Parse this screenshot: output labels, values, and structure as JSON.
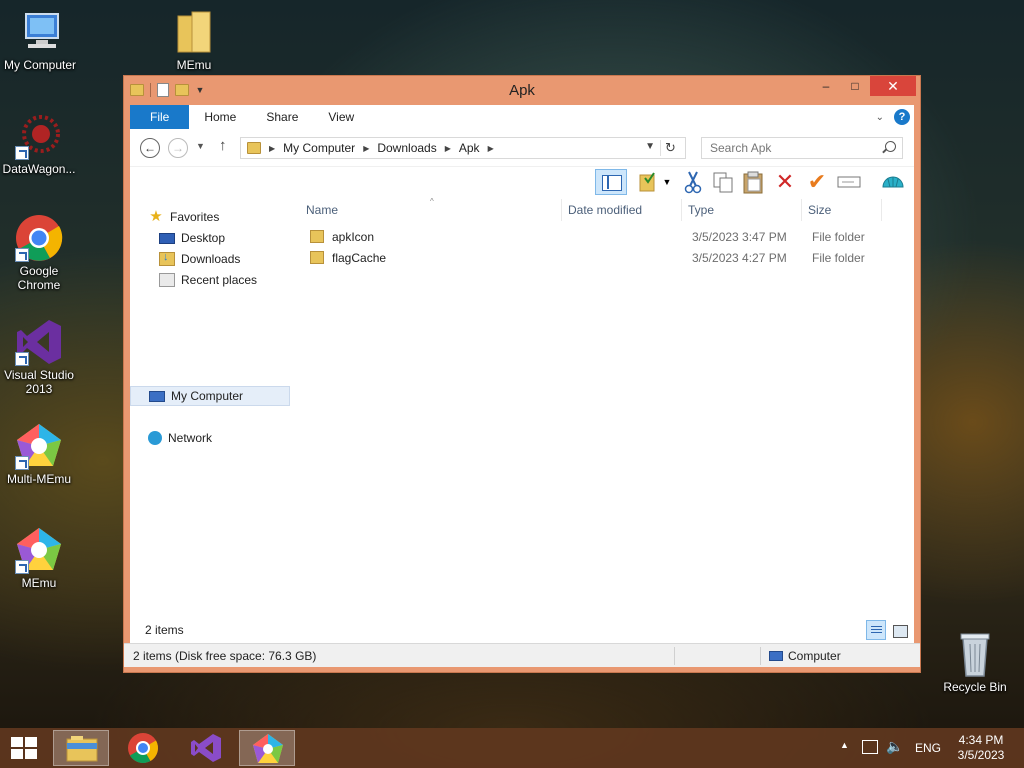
{
  "desktop": {
    "icons": [
      {
        "label": "My Computer"
      },
      {
        "label": "MEmu"
      },
      {
        "label": "DataWagon..."
      },
      {
        "label": "Google Chrome"
      },
      {
        "label": "Visual Studio 2013"
      },
      {
        "label": "Multi-MEmu"
      },
      {
        "label": "MEmu"
      },
      {
        "label": "Recycle Bin"
      }
    ]
  },
  "window": {
    "title": "Apk",
    "controls": {
      "minimize": "–",
      "maximize": "□",
      "close": "✕"
    },
    "ribbon_tabs": [
      {
        "label": "File"
      },
      {
        "label": "Home"
      },
      {
        "label": "Share"
      },
      {
        "label": "View"
      }
    ],
    "address": {
      "crumbs": [
        "My Computer",
        "Downloads",
        "Apk"
      ]
    },
    "search": {
      "placeholder": "Search Apk"
    },
    "nav_pane": {
      "favorites": "Favorites",
      "items": [
        "Desktop",
        "Downloads",
        "Recent places"
      ],
      "computer": "My Computer",
      "network": "Network"
    },
    "columns": [
      "Name",
      "Date modified",
      "Type",
      "Size"
    ],
    "files": [
      {
        "name": "apkIcon",
        "modified": "3/5/2023 3:47 PM",
        "type": "File folder",
        "size": ""
      },
      {
        "name": "flagCache",
        "modified": "3/5/2023 4:27 PM",
        "type": "File folder",
        "size": ""
      }
    ],
    "item_count": "2 items",
    "status": {
      "text": "2 items (Disk free space: 76.3 GB)",
      "location": "Computer"
    }
  },
  "taskbar": {
    "language": "ENG",
    "time": "4:34 PM",
    "date": "3/5/2023"
  }
}
